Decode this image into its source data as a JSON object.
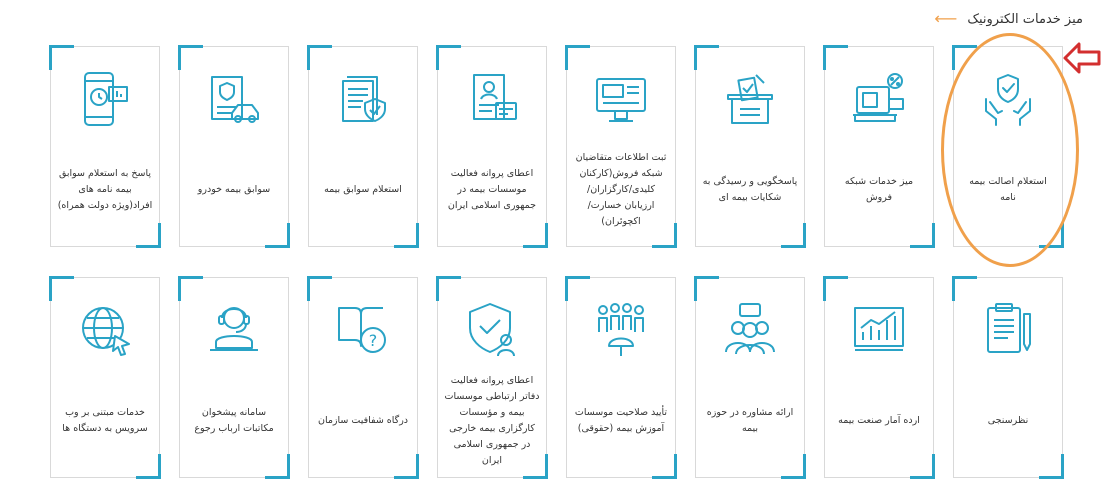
{
  "header": {
    "title": "میز خدمات الکترونیک",
    "arrow": "⟵"
  },
  "cards_row1": [
    {
      "label": "استعلام اصالت بیمه نامه",
      "icon": "shield-hands-icon"
    },
    {
      "label": "میز خدمات شبکه فروش",
      "icon": "sales-network-icon"
    },
    {
      "label": "پاسخگویی و رسیدگی به شکایات بیمه ای",
      "icon": "complaint-ballot-icon"
    },
    {
      "label": "ثبت اطلاعات متقاضیان شبکه فروش(کارکنان کلیدی/کارگزاران/ ارزیابان خسارت/ اکچوئران)",
      "icon": "monitor-registration-icon"
    },
    {
      "label": "اعطای پروانه فعالیت موسسات بیمه در جمهوری اسلامی ایران",
      "icon": "license-document-icon"
    },
    {
      "label": "استعلام سوابق بیمه",
      "icon": "insurance-records-icon"
    },
    {
      "label": "سوابق بیمه خودرو",
      "icon": "car-insurance-icon"
    },
    {
      "label": "پاسخ به استعلام سوابق بیمه نامه های افراد(ویژه دولت همراه)",
      "icon": "mobile-gov-icon"
    }
  ],
  "cards_row2": [
    {
      "label": "نظرسنجی",
      "icon": "survey-clipboard-icon"
    },
    {
      "label": "ارده آمار صنعت بیمه",
      "icon": "statistics-chart-icon"
    },
    {
      "label": "ارائه مشاوره در حوزه بیمه",
      "icon": "consultation-icon"
    },
    {
      "label": "تأیید صلاحیت موسسات آموزش بیمه (حقوقی)",
      "icon": "qualification-people-icon"
    },
    {
      "label": "اعطای پروانه فعالیت دفاتر ارتباطی موسسات بیمه و مؤسسات کارگزاری بیمه خارجی در جمهوری اسلامی ایران",
      "icon": "shield-person-icon"
    },
    {
      "label": "درگاه شفافیت سازمان",
      "icon": "transparency-book-icon"
    },
    {
      "label": "سامانه پیشخوان مکاتبات ارباب رجوع",
      "icon": "support-agent-icon"
    },
    {
      "label": "خدمات مبتنی بر وب سرویس به دستگاه ها",
      "icon": "web-globe-icon"
    }
  ],
  "colors": {
    "accent": "#2aa3c6",
    "highlight": "#f0a04b",
    "pointer": "#d32f2f",
    "text": "#333333"
  }
}
